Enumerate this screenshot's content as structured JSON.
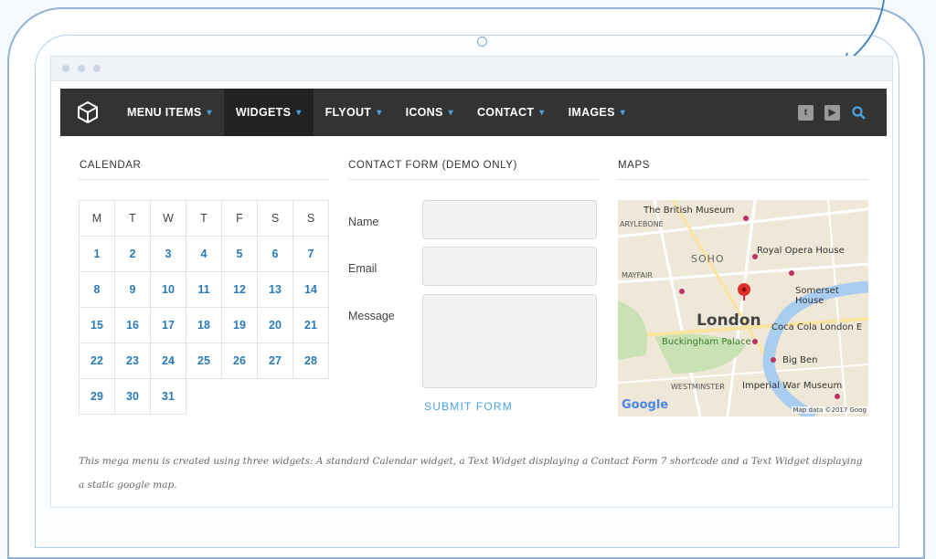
{
  "nav": {
    "items": [
      {
        "label": "MENU ITEMS",
        "active": false
      },
      {
        "label": "WIDGETS",
        "active": true
      },
      {
        "label": "FLYOUT",
        "active": false
      },
      {
        "label": "ICONS",
        "active": false
      },
      {
        "label": "CONTACT",
        "active": false
      },
      {
        "label": "IMAGES",
        "active": false
      }
    ],
    "icons": [
      "twitter-icon",
      "youtube-icon",
      "search-icon"
    ],
    "accent": "#4aa3df"
  },
  "calendar": {
    "title": "CALENDAR",
    "days": [
      "M",
      "T",
      "W",
      "T",
      "F",
      "S",
      "S"
    ],
    "weeks": [
      [
        "1",
        "2",
        "3",
        "4",
        "5",
        "6",
        "7"
      ],
      [
        "8",
        "9",
        "10",
        "11",
        "12",
        "13",
        "14"
      ],
      [
        "15",
        "16",
        "17",
        "18",
        "19",
        "20",
        "21"
      ],
      [
        "22",
        "23",
        "24",
        "25",
        "26",
        "27",
        "28"
      ],
      [
        "29",
        "30",
        "31"
      ]
    ]
  },
  "form": {
    "title": "CONTACT FORM (DEMO ONLY)",
    "name_label": "Name",
    "email_label": "Email",
    "message_label": "Message",
    "submit_label": "SUBMIT FORM"
  },
  "maps": {
    "title": "MAPS",
    "labels": {
      "museum": "The British Museum",
      "marylebone": "ARYLEBONE",
      "soho": "SOHO",
      "opera": "Royal Opera House",
      "mayfair": "MAYFAIR",
      "somerset": "Somerset House",
      "london": "London",
      "cocacola": "Coca Cola London E",
      "palace": "Buckingham Palace",
      "bigben": "Big Ben",
      "westminster": "WESTMINSTER",
      "war": "Imperial War Museum",
      "google": "Google",
      "mapdata": "Map data ©2017 Goog"
    }
  },
  "caption": "This mega menu is created using three widgets: A standard Calendar widget, a Text Widget displaying a Contact Form 7 shortcode and a Text Widget displaying a static google map."
}
